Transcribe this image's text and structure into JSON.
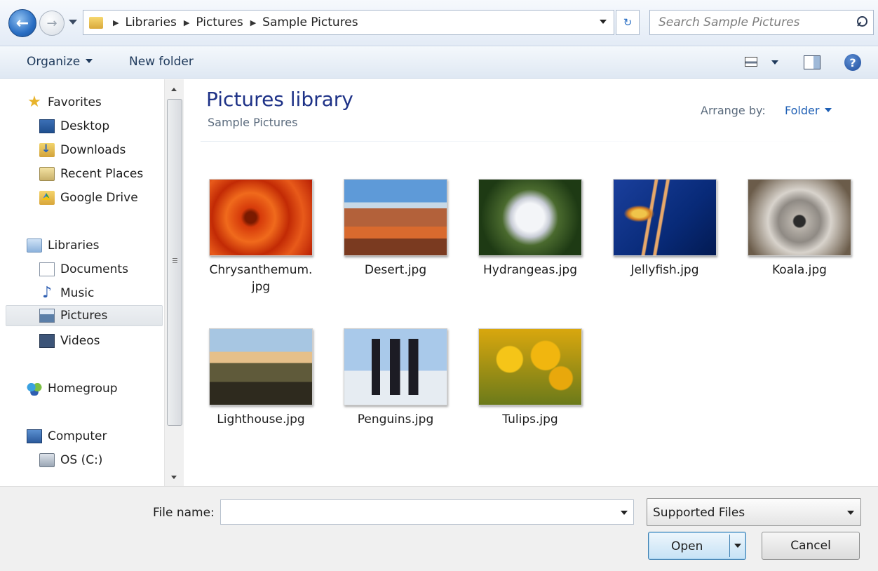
{
  "address": {
    "breadcrumbs": [
      "Libraries",
      "Pictures",
      "Sample Pictures"
    ],
    "search_placeholder": "Search Sample Pictures"
  },
  "toolbar": {
    "organize_label": "Organize",
    "new_folder_label": "New folder"
  },
  "nav": {
    "favorites": "Favorites",
    "desktop": "Desktop",
    "downloads": "Downloads",
    "recent_places": "Recent Places",
    "google_drive": "Google Drive",
    "libraries": "Libraries",
    "documents": "Documents",
    "music": "Music",
    "pictures": "Pictures",
    "videos": "Videos",
    "homegroup": "Homegroup",
    "computer": "Computer",
    "os_drive": "OS (C:)",
    "selected": "Pictures"
  },
  "content": {
    "title": "Pictures library",
    "subtitle": "Sample Pictures",
    "arrange_label": "Arrange by:",
    "arrange_value": "Folder",
    "files": [
      {
        "name": "Chrysanthemum.",
        "name2": "jpg"
      },
      {
        "name": "Desert.jpg"
      },
      {
        "name": "Hydrangeas.jpg"
      },
      {
        "name": "Jellyfish.jpg"
      },
      {
        "name": "Koala.jpg"
      },
      {
        "name": "Lighthouse.jpg"
      },
      {
        "name": "Penguins.jpg"
      },
      {
        "name": "Tulips.jpg"
      }
    ]
  },
  "footer": {
    "file_name_label": "File name:",
    "file_name_value": "",
    "file_type_value": "Supported Files",
    "open_label": "Open",
    "cancel_label": "Cancel"
  }
}
